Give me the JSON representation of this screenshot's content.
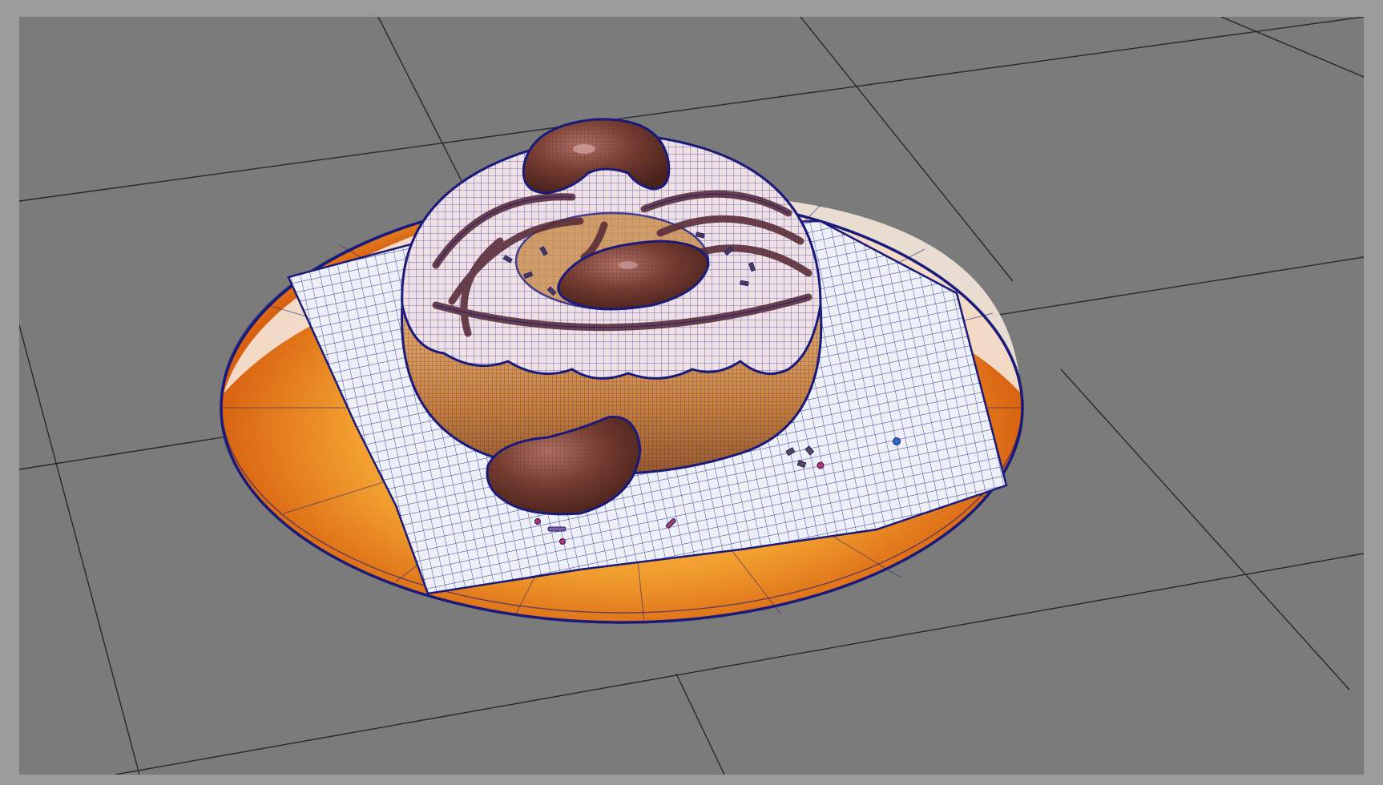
{
  "viewport": {
    "mode": "wireframe-on-shaded",
    "background_color": "#7b7b7b",
    "frame_color": "#9b9b9b",
    "grid_line_color": "#1a1a1a",
    "wire_color": "#1a1a7a"
  },
  "scene": {
    "objects": [
      {
        "name": "plate",
        "color": "#f0a030",
        "rim_color": "#f6e6d6"
      },
      {
        "name": "napkin",
        "color": "#eef0f8"
      },
      {
        "name": "donut",
        "dough_color": "#c8803a",
        "icing_color": "#efe0e0"
      },
      {
        "name": "chocolate-drizzle",
        "color": "#6a3a3a"
      },
      {
        "name": "chocolate-pieces",
        "count": 3,
        "color": "#7a3e2e"
      },
      {
        "name": "sprinkles",
        "color": "#3a3a8a"
      }
    ]
  }
}
